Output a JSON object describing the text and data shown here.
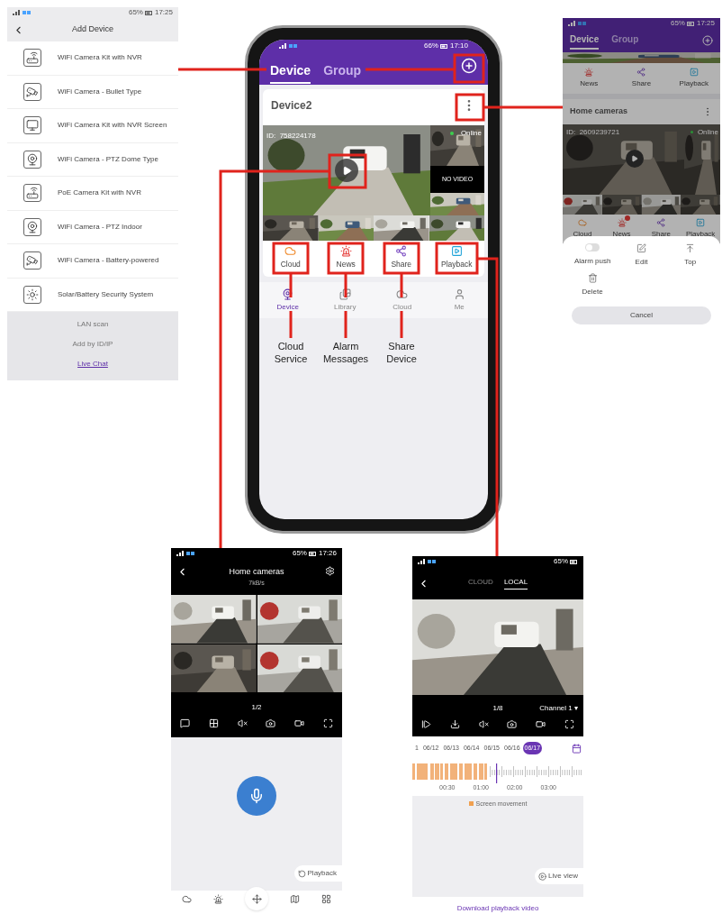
{
  "add_device": {
    "status": {
      "time": "17:25",
      "battery": "65%"
    },
    "title": "Add Device",
    "items": [
      "WiFi Camera Kit with NVR",
      "WiFi Camera - Bullet Type",
      "WiFi Camera Kit with NVR Screen",
      "WiFi Camera - PTZ Dome Type",
      "PoE Camera Kit with NVR",
      "WiFi Camera - PTZ Indoor",
      "WiFi Camera - Battery-powered",
      "Solar/Battery Security System"
    ],
    "links": [
      "LAN scan",
      "Add by ID/IP",
      "Live Chat"
    ]
  },
  "device_list": {
    "status": {
      "time": "17:10",
      "battery": "66%"
    },
    "tabs": [
      {
        "label": "Device",
        "selected": true
      },
      {
        "label": "Group",
        "selected": false
      }
    ],
    "device": {
      "name": "Device2",
      "id": "ID:  758224178",
      "status": "Online",
      "no_video": "NO VIDEO"
    },
    "actions": [
      {
        "kind": "cloud",
        "label": "Cloud"
      },
      {
        "kind": "alarm",
        "label": "News"
      },
      {
        "kind": "share",
        "label": "Share"
      },
      {
        "kind": "playback",
        "label": "Playback"
      }
    ],
    "nav": [
      {
        "kind": "device",
        "label": "Device",
        "selected": true
      },
      {
        "kind": "library",
        "label": "Library",
        "selected": false
      },
      {
        "kind": "cloud",
        "label": "Cloud",
        "selected": false
      },
      {
        "kind": "me",
        "label": "Me",
        "selected": false
      }
    ]
  },
  "callouts": [
    "Cloud Service",
    "Alarm Messages",
    "Share Device"
  ],
  "device_menu": {
    "status": {
      "time": "17:25",
      "battery": "65%"
    },
    "tabs": [
      {
        "label": "Device",
        "selected": true
      },
      {
        "label": "Group",
        "selected": false
      }
    ],
    "actions_above": [
      {
        "kind": "alarm",
        "label": "News",
        "badge": false
      },
      {
        "kind": "share",
        "label": "Share",
        "badge": false
      },
      {
        "kind": "playback",
        "label": "Playback",
        "badge": false
      }
    ],
    "device": {
      "name": "Home cameras",
      "id": "ID:  2609239721",
      "status": "Online"
    },
    "actions": [
      {
        "kind": "cloud",
        "label": "Cloud",
        "badge": false
      },
      {
        "kind": "alarm",
        "label": "News",
        "badge": true
      },
      {
        "kind": "share",
        "label": "Share",
        "badge": false
      },
      {
        "kind": "playback",
        "label": "Playback",
        "badge": false
      }
    ],
    "options": [
      {
        "kind": "toggle",
        "label": "Alarm push",
        "on": false
      },
      {
        "kind": "edit",
        "label": "Edit"
      },
      {
        "kind": "top",
        "label": "Top"
      },
      {
        "kind": "delete",
        "label": "Delete"
      }
    ],
    "cancel": "Cancel"
  },
  "live_view": {
    "status": {
      "time": "17:26",
      "battery": "65%"
    },
    "title": "Home cameras",
    "subtitle": "7kB/s",
    "page": "1/2",
    "playback": "Playback"
  },
  "playback": {
    "status": {
      "battery": "65%"
    },
    "tabs": [
      {
        "label": "CLOUD",
        "selected": false
      },
      {
        "label": "LOCAL",
        "selected": true
      }
    ],
    "page": "1/8",
    "channel": "Channel 1 ▾",
    "dates": [
      {
        "label": "1",
        "selected": false
      },
      {
        "label": "06/12",
        "selected": false
      },
      {
        "label": "06/13",
        "selected": false
      },
      {
        "label": "06/14",
        "selected": false
      },
      {
        "label": "06/15",
        "selected": false
      },
      {
        "label": "06/16",
        "selected": false
      },
      {
        "label": "06/17",
        "selected": true
      }
    ],
    "times": [
      "00:30",
      "01:00",
      "02:00",
      "03:00"
    ],
    "legend": "Screen movement",
    "live_view": "Live view"
  },
  "download_link": "Download playback video"
}
